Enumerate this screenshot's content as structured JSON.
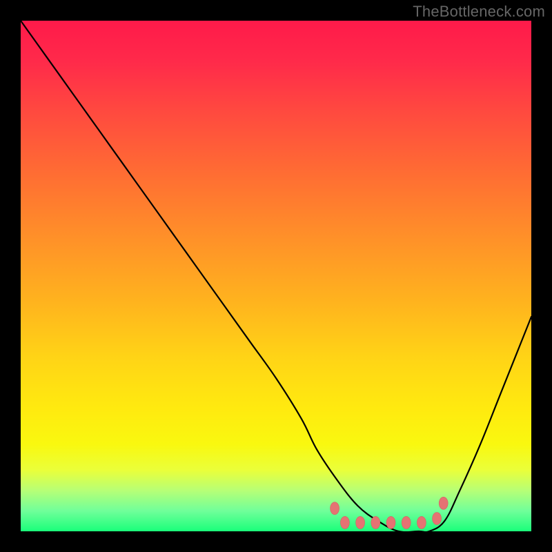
{
  "watermark": "TheBottleneck.com",
  "gradient": {
    "stops": [
      {
        "offset": 0.0,
        "color": "#ff1a4a"
      },
      {
        "offset": 0.08,
        "color": "#ff2a4a"
      },
      {
        "offset": 0.18,
        "color": "#ff4a3f"
      },
      {
        "offset": 0.3,
        "color": "#ff6d33"
      },
      {
        "offset": 0.42,
        "color": "#ff8f29"
      },
      {
        "offset": 0.55,
        "color": "#ffb31e"
      },
      {
        "offset": 0.66,
        "color": "#ffd416"
      },
      {
        "offset": 0.76,
        "color": "#ffea0f"
      },
      {
        "offset": 0.83,
        "color": "#f9f80f"
      },
      {
        "offset": 0.88,
        "color": "#eaff3a"
      },
      {
        "offset": 0.92,
        "color": "#b7ff76"
      },
      {
        "offset": 0.96,
        "color": "#70ff9a"
      },
      {
        "offset": 1.0,
        "color": "#1aff7a"
      }
    ]
  },
  "chart_data": {
    "type": "line",
    "title": "",
    "xlabel": "",
    "ylabel": "",
    "xlim": [
      0,
      100
    ],
    "ylim": [
      0,
      100
    ],
    "series": [
      {
        "name": "bottleneck-curve",
        "x": [
          0,
          5,
          10,
          15,
          20,
          25,
          30,
          35,
          40,
          45,
          50,
          55,
          58,
          62,
          66,
          70,
          74,
          78,
          80,
          83,
          86,
          90,
          94,
          100
        ],
        "values": [
          100,
          93,
          86,
          79,
          72,
          65,
          58,
          51,
          44,
          37,
          30,
          22,
          16,
          10,
          5,
          2,
          0,
          0,
          0,
          2,
          8,
          17,
          27,
          42
        ]
      }
    ],
    "optimal_zone": {
      "x_start": 61,
      "x_end": 82,
      "y": 2
    },
    "optimal_markers": [
      {
        "x": 61.5,
        "y": 4.5
      },
      {
        "x": 63.5,
        "y": 1.7
      },
      {
        "x": 66.5,
        "y": 1.7
      },
      {
        "x": 69.5,
        "y": 1.7
      },
      {
        "x": 72.5,
        "y": 1.7
      },
      {
        "x": 75.5,
        "y": 1.7
      },
      {
        "x": 78.5,
        "y": 1.7
      },
      {
        "x": 81.5,
        "y": 2.5
      },
      {
        "x": 82.8,
        "y": 5.5
      }
    ],
    "colors": {
      "curve": "#000000",
      "marker_fill": "#e57373",
      "marker_stroke": "#d46060"
    }
  }
}
